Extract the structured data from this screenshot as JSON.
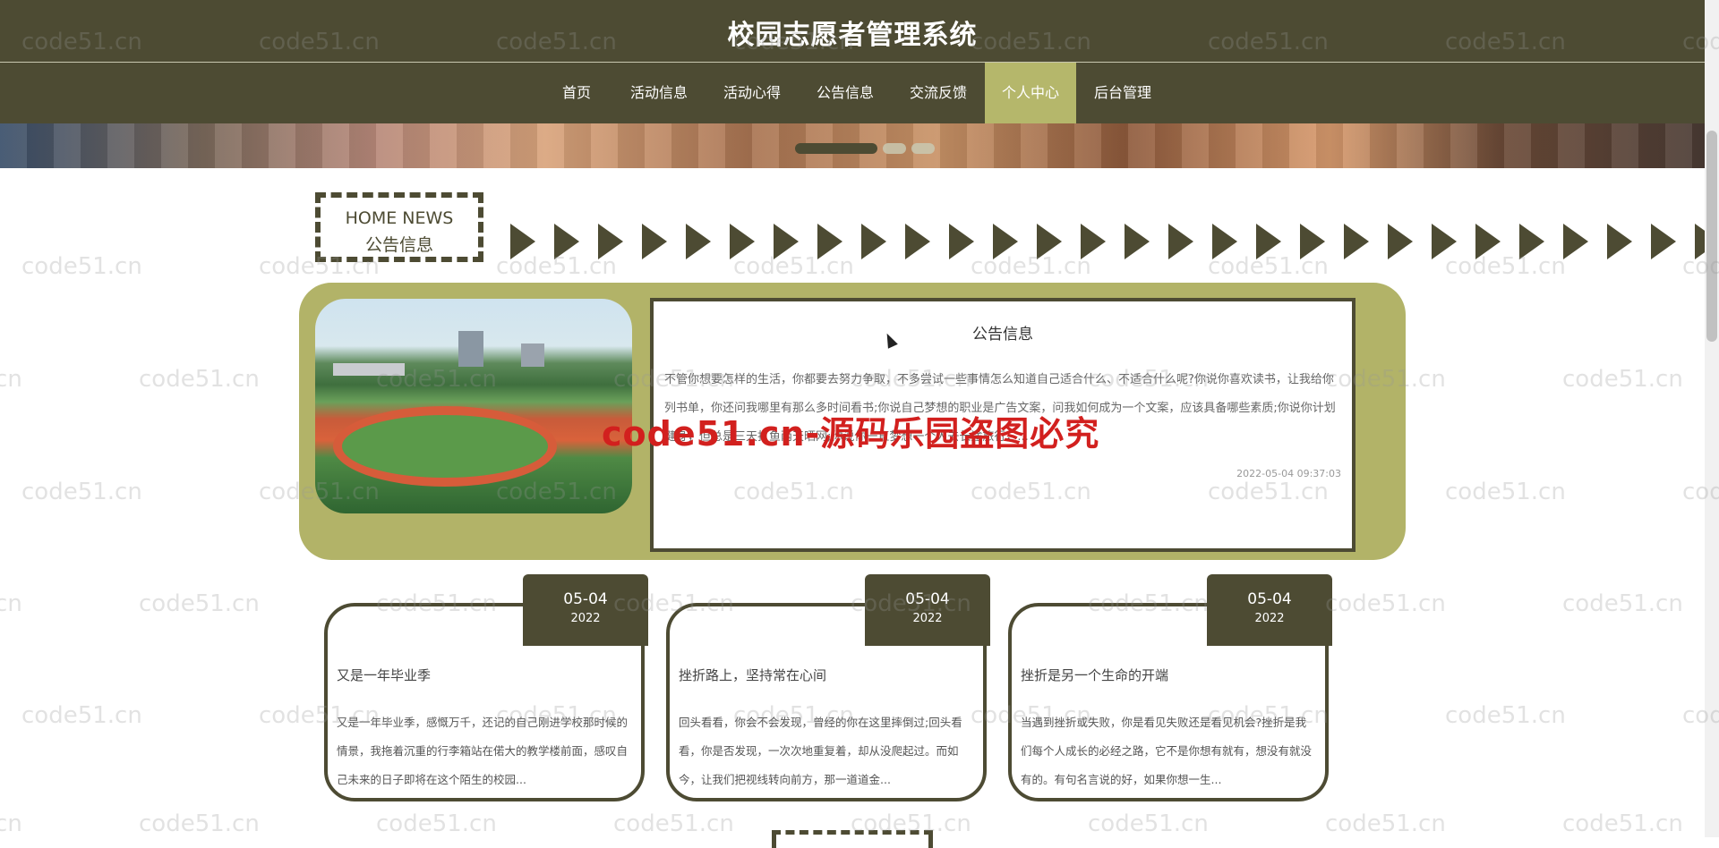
{
  "header": {
    "title": "校园志愿者管理系统"
  },
  "nav": {
    "items": [
      {
        "label": "首页",
        "active": false
      },
      {
        "label": "活动信息",
        "active": false
      },
      {
        "label": "活动心得",
        "active": false
      },
      {
        "label": "公告信息",
        "active": false
      },
      {
        "label": "交流反馈",
        "active": false
      },
      {
        "label": "个人中心",
        "active": true
      },
      {
        "label": "后台管理",
        "active": false
      }
    ]
  },
  "carousel": {
    "slide_count": 3,
    "active_index": 0
  },
  "section": {
    "title_en": "HOME NEWS",
    "title_cn": "公告信息"
  },
  "featured": {
    "title": "公告信息",
    "text": "不管你想要怎样的生活，你都要去努力争取，不多尝试一些事情怎么知道自己适合什么、不适合什么呢?你说你喜欢读书，让我给你列书单，你还问我哪里有那么多时间看书;你说自己梦想的职业是广告文案，问我如何成为一个文案，应该具备哪些素质;你说你计划健身，但总是三天打鱼两天晒网;你说你一直梦想一个人去长途旅行，...",
    "time": "2022-05-04 09:37:03"
  },
  "news": [
    {
      "date_md": "05-04",
      "date_y": "2022",
      "title": "又是一年毕业季",
      "text": "又是一年毕业季，感慨万千，还记的自己刚进学校那时候的情景，我拖着沉重的行李箱站在偌大的教学楼前面，感叹自己未来的日子即将在这个陌生的校园..."
    },
    {
      "date_md": "05-04",
      "date_y": "2022",
      "title": "挫折路上，坚持常在心间",
      "text": "回头看看，你会不会发现，曾经的你在这里摔倒过;回头看看，你是否发现，一次次地重复着，却从没爬起过。而如今，让我们把视线转向前方，那一道道金..."
    },
    {
      "date_md": "05-04",
      "date_y": "2022",
      "title": "挫折是另一个生命的开端",
      "text": "当遇到挫折或失败，你是看见失败还是看见机会?挫折是我们每个人成长的必经之路，它不是你想有就有，想没有就没有的。有句名言说的好，如果你想一生..."
    }
  ],
  "watermark": {
    "text": "code51.cn",
    "notice": "code51.cn-源码乐园盗图必究"
  },
  "colors": {
    "primary": "#4d4b33",
    "accent": "#b5b76b",
    "feature_bg": "#b2b368"
  }
}
